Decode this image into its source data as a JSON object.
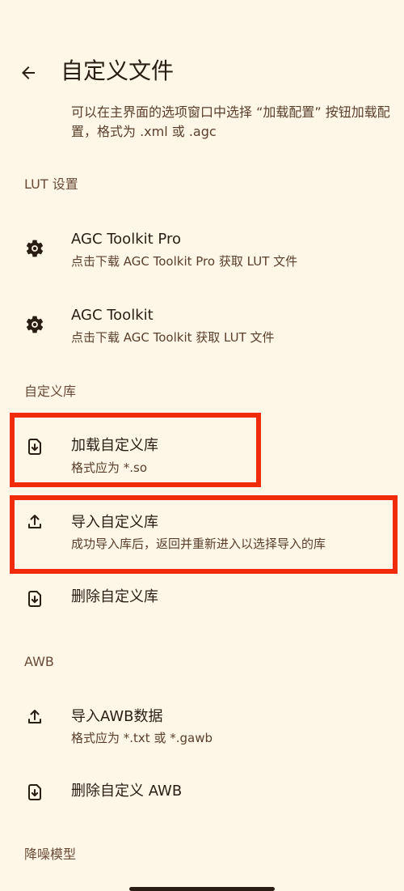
{
  "header": {
    "title": "自定义文件"
  },
  "description": "可以在主界面的选项窗口中选择 “加载配置” 按钮加载配置，格式为 .xml 或 .agc",
  "sections": {
    "lut": "LUT 设置",
    "lib": "自定义库",
    "awb": "AWB",
    "noise": "降噪模型"
  },
  "items": {
    "agc_pro": {
      "title": "AGC Toolkit Pro",
      "subtitle": "点击下载 AGC Toolkit Pro 获取 LUT 文件",
      "icon": "gear-icon"
    },
    "agc": {
      "title": "AGC Toolkit",
      "subtitle": "点击下载 AGC Toolkit 获取 LUT 文件",
      "icon": "gear-icon"
    },
    "load_lib": {
      "title": "加载自定义库",
      "subtitle": "格式应为 *.so",
      "icon": "file-download-icon"
    },
    "import_lib": {
      "title": "导入自定义库",
      "subtitle": "成功导入库后，返回并重新进入以选择导入的库",
      "icon": "upload-icon"
    },
    "delete_lib": {
      "title": "删除自定义库",
      "icon": "file-download-icon"
    },
    "import_awb": {
      "title": "导入AWB数据",
      "subtitle": "格式应为 *.txt 或 *.gawb",
      "icon": "upload-icon"
    },
    "delete_awb": {
      "title": "删除自定义 AWB",
      "icon": "file-download-icon"
    }
  },
  "colors": {
    "background": "#FEF7E8",
    "highlight": "#F12B0A",
    "text": "#2A1D14"
  }
}
